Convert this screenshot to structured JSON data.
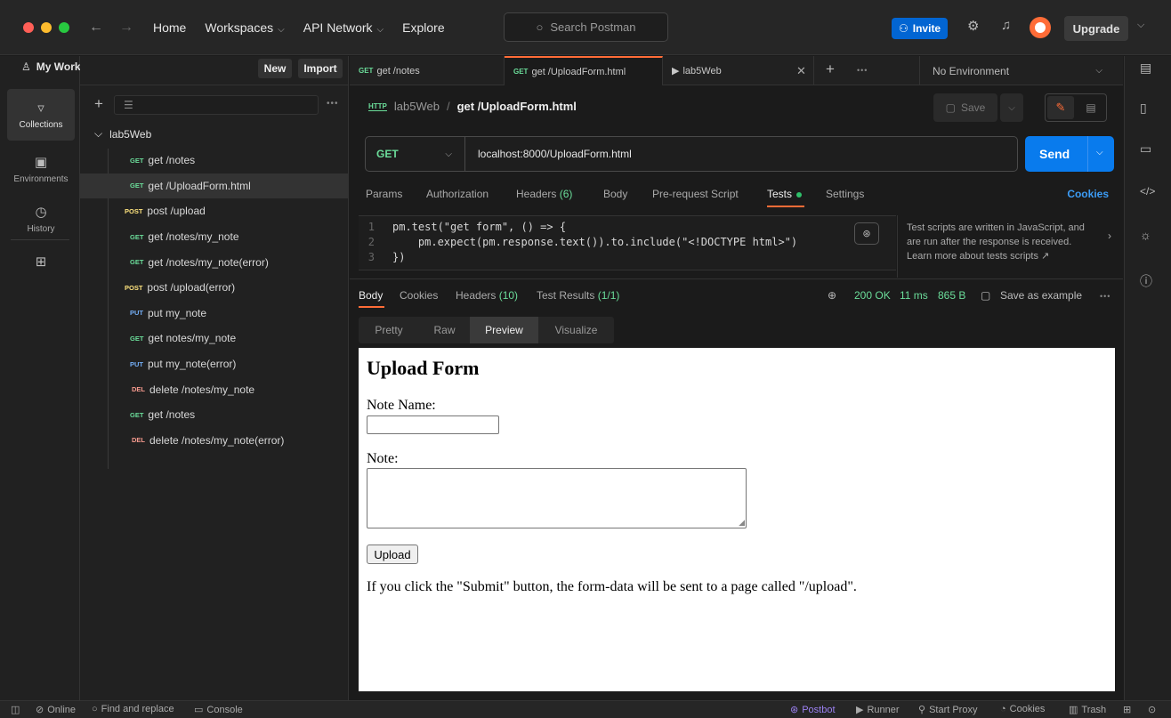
{
  "titlebar": {
    "nav": [
      "Home",
      "Workspaces",
      "API Network",
      "Explore"
    ],
    "search_placeholder": "Search Postman",
    "invite": "Invite",
    "upgrade": "Upgrade"
  },
  "rail": {
    "items": [
      {
        "label": "Collections",
        "icon": "collections-icon"
      },
      {
        "label": "Environments",
        "icon": "environments-icon"
      },
      {
        "label": "History",
        "icon": "history-icon"
      },
      {
        "label": "",
        "icon": "apps-icon"
      }
    ]
  },
  "sidebar": {
    "workspace": "My Workspace",
    "new_label": "New",
    "import_label": "Import",
    "collection": "lab5Web",
    "requests": [
      {
        "method": "GET",
        "name": "get /notes"
      },
      {
        "method": "GET",
        "name": "get /UploadForm.html"
      },
      {
        "method": "POST",
        "name": "post /upload"
      },
      {
        "method": "GET",
        "name": "get /notes/my_note"
      },
      {
        "method": "GET",
        "name": "get /notes/my_note(error)"
      },
      {
        "method": "POST",
        "name": "post /upload(error)"
      },
      {
        "method": "PUT",
        "name": "put my_note"
      },
      {
        "method": "GET",
        "name": "get notes/my_note"
      },
      {
        "method": "PUT",
        "name": "put my_note(error)"
      },
      {
        "method": "DEL",
        "name": "delete /notes/my_note"
      },
      {
        "method": "GET",
        "name": "get /notes"
      },
      {
        "method": "DEL",
        "name": "delete /notes/my_note(error)"
      }
    ]
  },
  "tabs": {
    "items": [
      {
        "method": "GET",
        "label": "get /notes"
      },
      {
        "method": "GET",
        "label": "get /UploadForm.html"
      },
      {
        "method": "",
        "label": "lab5Web"
      }
    ],
    "environment": "No Environment"
  },
  "request": {
    "breadcrumb_collection": "lab5Web",
    "breadcrumb_request": "get /UploadForm.html",
    "save_label": "Save",
    "method": "GET",
    "url": "localhost:8000/UploadForm.html",
    "send_label": "Send",
    "tabs": {
      "params": "Params",
      "authorization": "Authorization",
      "headers": "Headers",
      "headers_count": "(6)",
      "body": "Body",
      "prerequest": "Pre-request Script",
      "tests": "Tests",
      "settings": "Settings",
      "cookies": "Cookies"
    },
    "code_lines": [
      {
        "n": "1",
        "text": "pm.test(\"get form\", () => {"
      },
      {
        "n": "2",
        "text": "    pm.expect(pm.response.text()).to.include(\"<!DOCTYPE html>\")"
      },
      {
        "n": "3",
        "text": "})"
      }
    ],
    "snippet_help": "Test scripts are written in JavaScript, and are run after the response is received. Learn more about tests scripts ↗"
  },
  "response": {
    "tabs": {
      "body": "Body",
      "cookies": "Cookies",
      "headers": "Headers",
      "headers_count": "(10)",
      "test_results": "Test Results",
      "test_count": "(1/1)"
    },
    "status": "200 OK",
    "time": "11 ms",
    "size": "865 B",
    "save_example": "Save as example",
    "views": [
      "Pretty",
      "Raw",
      "Preview",
      "Visualize"
    ]
  },
  "preview": {
    "title": "Upload Form",
    "note_name_label": "Note Name:",
    "note_label": "Note:",
    "upload_button": "Upload",
    "info_text": "If you click the \"Submit\" button, the form-data will be sent to a page called \"/upload\"."
  },
  "statusbar": {
    "online": "Online",
    "find_replace": "Find and replace",
    "console": "Console",
    "postbot": "Postbot",
    "runner": "Runner",
    "start_proxy": "Start Proxy",
    "cookies": "Cookies",
    "trash": "Trash"
  },
  "colors": {
    "accent": "#ff6c37",
    "send": "#097bed",
    "get": "#6bdd9a",
    "post": "#ffe47e",
    "put": "#74aef6",
    "delete": "#f79a8e"
  }
}
